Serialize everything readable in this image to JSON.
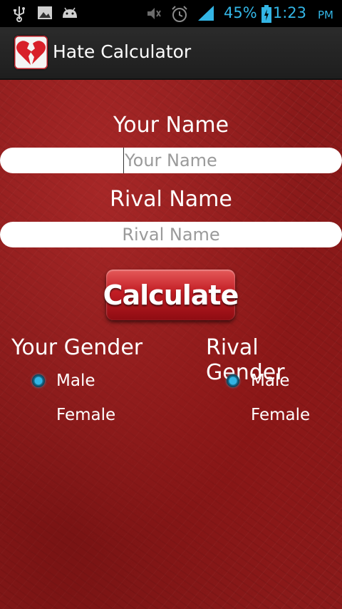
{
  "status_bar": {
    "left_icons": [
      "usb-icon",
      "image-icon",
      "android-icon"
    ],
    "right_icons": [
      "volume-mute-icon",
      "alarm-icon",
      "signal-icon",
      "battery-icon"
    ],
    "battery_percent": "45%",
    "time": "1:23",
    "ampm": "PM",
    "accent_color": "#33b5e5"
  },
  "action_bar": {
    "app_icon": "broken-heart-icon",
    "title": "Hate Calculator"
  },
  "form": {
    "your_name_label": "Your Name",
    "your_name_value": "",
    "your_name_placeholder": "Your Name",
    "rival_name_label": "Rival Name",
    "rival_name_value": "",
    "rival_name_placeholder": "Rival Name",
    "calculate_label": "Calculate"
  },
  "your_gender": {
    "title": "Your Gender",
    "options": [
      {
        "label": "Male",
        "checked": true
      },
      {
        "label": "Female",
        "checked": false
      }
    ]
  },
  "rival_gender": {
    "title": "Rival Gender",
    "options": [
      {
        "label": "Male",
        "checked": true
      },
      {
        "label": "Female",
        "checked": false
      }
    ]
  },
  "colors": {
    "background": "#8a1a1a",
    "button": "#c21d24",
    "radio_checked": "#33b5e5"
  }
}
